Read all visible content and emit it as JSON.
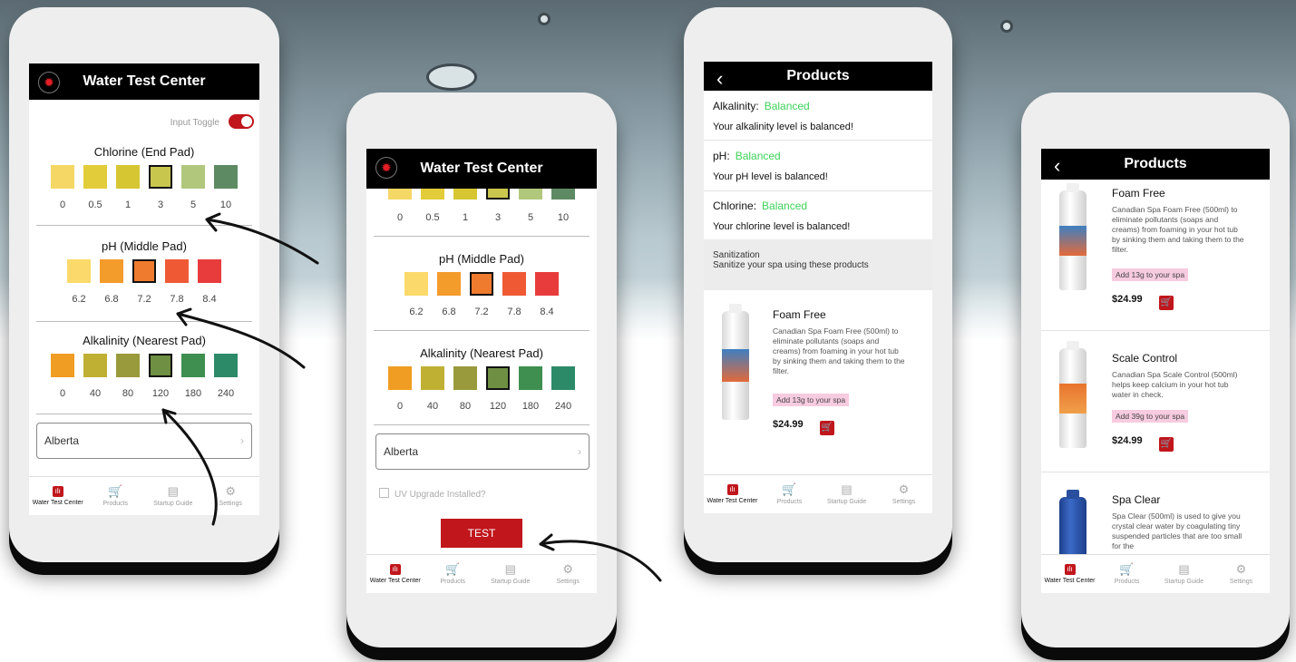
{
  "colors": {
    "accent": "#c0161c",
    "balanced": "#3ed35a",
    "header": "#000000"
  },
  "phone1": {
    "title": "Water Test Center",
    "logo_icon": "maple-leaf-icon",
    "input_toggle_label": "Input Toggle",
    "chlorine": {
      "title": "Chlorine (End Pad)",
      "labels": [
        "0",
        "0.5",
        "1",
        "3",
        "5",
        "10"
      ],
      "colors": [
        "#f5d765",
        "#e3cc3a",
        "#d6c632",
        "#c9c64e",
        "#b1c77b",
        "#5e8a63"
      ],
      "selected_index": 3
    },
    "ph": {
      "title": "pH (Middle Pad)",
      "labels": [
        "6.2",
        "6.8",
        "7.2",
        "7.8",
        "8.4"
      ],
      "colors": [
        "#fbd96b",
        "#f39b2b",
        "#ef7b2e",
        "#ef5a35",
        "#e83c3c"
      ],
      "selected_index": 2
    },
    "alkalinity": {
      "title": "Alkalinity (Nearest Pad)",
      "labels": [
        "0",
        "40",
        "80",
        "120",
        "180",
        "240"
      ],
      "colors": [
        "#f09d24",
        "#bfb033",
        "#999a3b",
        "#6f8f42",
        "#3e8f50",
        "#2d8a68"
      ],
      "selected_index": 3
    },
    "province": "Alberta",
    "tabs": [
      "Water Test Center",
      "Products",
      "Startup Guide",
      "Settings"
    ]
  },
  "phone2": {
    "title": "Water Test Center",
    "logo_icon": "maple-leaf-icon",
    "chlorine_labels": [
      "0",
      "0.5",
      "1",
      "3",
      "5",
      "10"
    ],
    "ph": {
      "title": "pH (Middle Pad)",
      "labels": [
        "6.2",
        "6.8",
        "7.2",
        "7.8",
        "8.4"
      ]
    },
    "alkalinity": {
      "title": "Alkalinity (Nearest Pad)",
      "labels": [
        "0",
        "40",
        "80",
        "120",
        "180",
        "240"
      ]
    },
    "province": "Alberta",
    "uv_label": "UV Upgrade Installed?",
    "test_button": "TEST",
    "tabs": [
      "Water Test Center",
      "Products",
      "Startup Guide",
      "Settings"
    ]
  },
  "phone3": {
    "title": "Products",
    "alkalinity": {
      "label": "Alkalinity:",
      "status": "Balanced",
      "message": "Your alkalinity level is balanced!"
    },
    "ph": {
      "label": "pH:",
      "status": "Balanced",
      "message": "Your pH level is balanced!"
    },
    "chlorine": {
      "label": "Chlorine:",
      "status": "Balanced",
      "message": "Your chlorine level is balanced!"
    },
    "section_title": "Sanitization",
    "section_subtitle": "Sanitize your spa using these products",
    "product": {
      "name": "Foam Free",
      "description": "Canadian Spa Foam Free (500ml) to eliminate pollutants (soaps and creams) from foaming in your hot tub by sinking them and taking them to the filter.",
      "dose": "Add 13g to your spa",
      "price": "$24.99"
    },
    "tabs": [
      "Water Test Center",
      "Products",
      "Startup Guide",
      "Settings"
    ]
  },
  "phone4": {
    "title": "Products",
    "products": [
      {
        "name": "Foam Free",
        "description": "Canadian Spa Foam Free (500ml) to eliminate pollutants (soaps and creams) from foaming in your hot tub by sinking them and taking them to the filter.",
        "dose": "Add 13g to your spa",
        "price": "$24.99"
      },
      {
        "name": "Scale Control",
        "description": "Canadian Spa Scale Control (500ml) helps keep calcium in your hot tub water in check.",
        "dose": "Add 39g to your spa",
        "price": "$24.99"
      },
      {
        "name": "Spa Clear",
        "description": "Spa Clear (500ml) is used to give you crystal clear water by coagulating tiny suspended particles that are too small for the"
      }
    ],
    "tabs": [
      "Water Test Center",
      "Products",
      "Startup Guide",
      "Settings"
    ]
  }
}
